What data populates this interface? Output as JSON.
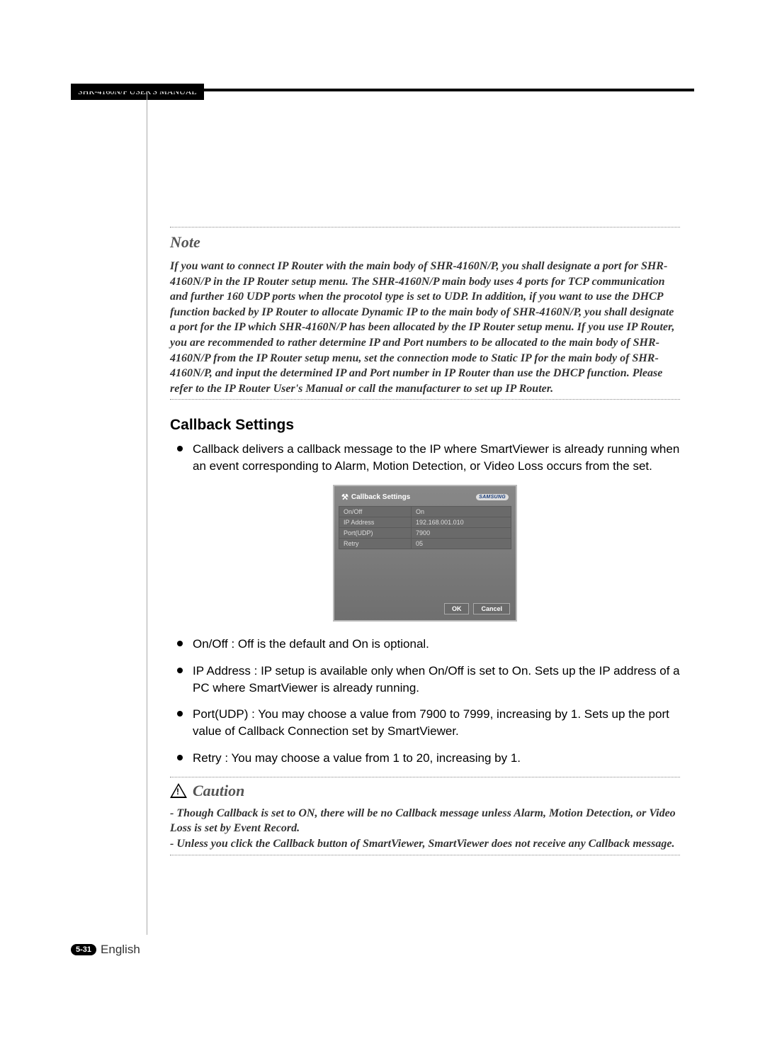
{
  "header": {
    "manual_title": "SHR-4160N/P USER'S MANUAL"
  },
  "note": {
    "title": "Note",
    "body": "If you want to connect IP Router with the main body of SHR-4160N/P, you shall designate a port for SHR-4160N/P in the IP Router setup menu. The SHR-4160N/P main body uses 4 ports for TCP communication and further 160 UDP ports when the procotol type is set  to UDP. In addition, if you want to use the DHCP function backed by IP Router to allocate Dynamic IP to the main body of SHR-4160N/P, you shall designate a port for the IP which SHR-4160N/P has been allocated by the IP Router setup menu. If you use IP Router, you are recommended to rather determine IP and Port numbers to be allocated to the main body of SHR-4160N/P from the IP Router setup menu, set the connection mode to Static IP for the main body of SHR-4160N/P, and input the determined IP and Port number in IP Router than use the DHCP function. Please refer to the IP Router User's Manual or call the manufacturer to set up IP Router."
  },
  "callback": {
    "title": "Callback Settings",
    "intro": "Callback delivers a callback message to the IP where SmartViewer is already running when an event corresponding to Alarm, Motion Detection, or Video Loss occurs from the set.",
    "bullets": [
      "On/Off : Off is the default and On is optional.",
      "IP Address : IP setup is available only when On/Off is set to On. Sets up the IP address of a PC where SmartViewer is already running.",
      "Port(UDP) : You may choose a value from 7900 to 7999, increasing by 1. Sets up the port value of Callback Connection set by SmartViewer.",
      "Retry : You may choose a value from 1 to 20, increasing by 1."
    ]
  },
  "screenshot": {
    "title": "Callback Settings",
    "brand": "SAMSUNG",
    "rows": [
      {
        "label": "On/Off",
        "value": "On"
      },
      {
        "label": "IP Address",
        "value": "192.168.001.010"
      },
      {
        "label": "Port(UDP)",
        "value": "7900"
      },
      {
        "label": "Retry",
        "value": "05"
      }
    ],
    "ok": "OK",
    "cancel": "Cancel"
  },
  "caution": {
    "title": "Caution",
    "line1": "- Though Callback is set to ON, there will be no Callback message unless Alarm, Motion Detection, or Video Loss is set by Event Record.",
    "line2": "- Unless you click the Callback button of SmartViewer, SmartViewer does not receive any Callback message."
  },
  "footer": {
    "page": "5-31",
    "lang": "English"
  }
}
